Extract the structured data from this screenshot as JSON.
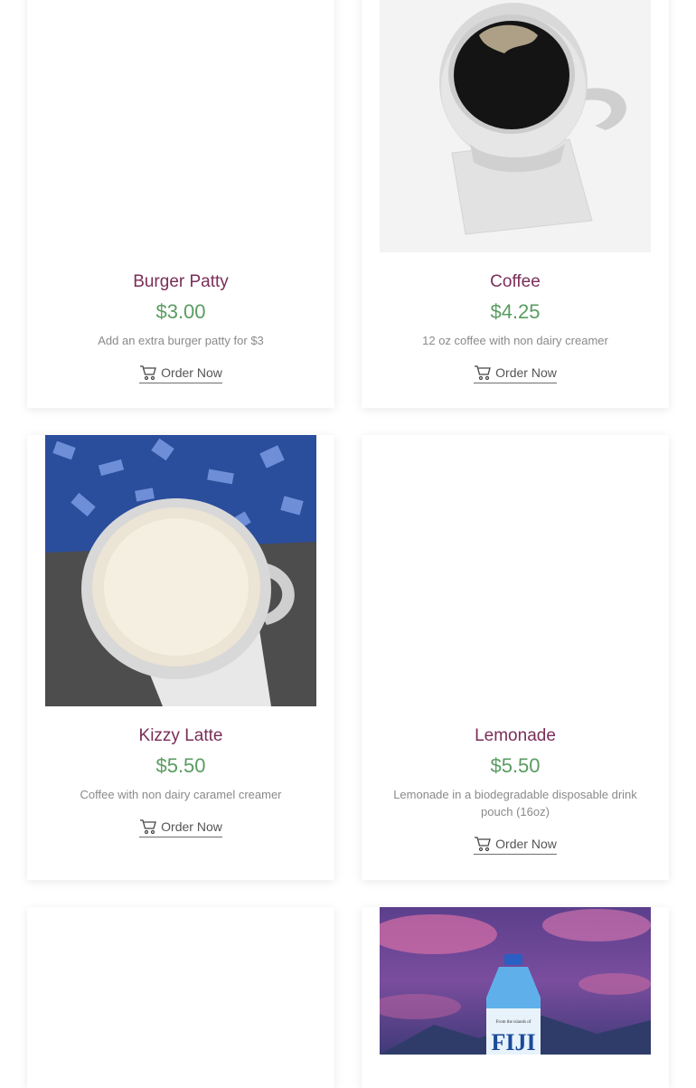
{
  "products": [
    {
      "name": "Burger Patty",
      "price": "$3.00",
      "description": "Add an extra burger patty for $3",
      "order_label": "Order Now",
      "cart_icon": "shopping-cart-icon"
    },
    {
      "name": "Coffee",
      "price": "$4.25",
      "description": "12 oz coffee with non dairy creamer",
      "order_label": "Order Now",
      "cart_icon": "shopping-cart-icon"
    },
    {
      "name": "Kizzy Latte",
      "price": "$5.50",
      "description": "Coffee with non dairy caramel creamer",
      "order_label": "Order Now",
      "cart_icon": "shopping-cart-icon"
    },
    {
      "name": "Lemonade",
      "price": "$5.50",
      "description": "Lemonade in a biodegradable disposable drink pouch (16oz)",
      "order_label": "Order Now",
      "cart_icon": "shopping-cart-icon"
    },
    {
      "name": "",
      "price": "",
      "description": "",
      "order_label": "",
      "cart_icon": ""
    },
    {
      "name": "",
      "price": "",
      "description": "",
      "order_label": "",
      "cart_icon": ""
    }
  ],
  "images": {
    "water_bottle_brand": "FIJI",
    "water_bottle_tagline": "From the islands of"
  },
  "colors": {
    "name": "#7a2e58",
    "price": "#5a9c61",
    "description": "#8a8a8a"
  }
}
